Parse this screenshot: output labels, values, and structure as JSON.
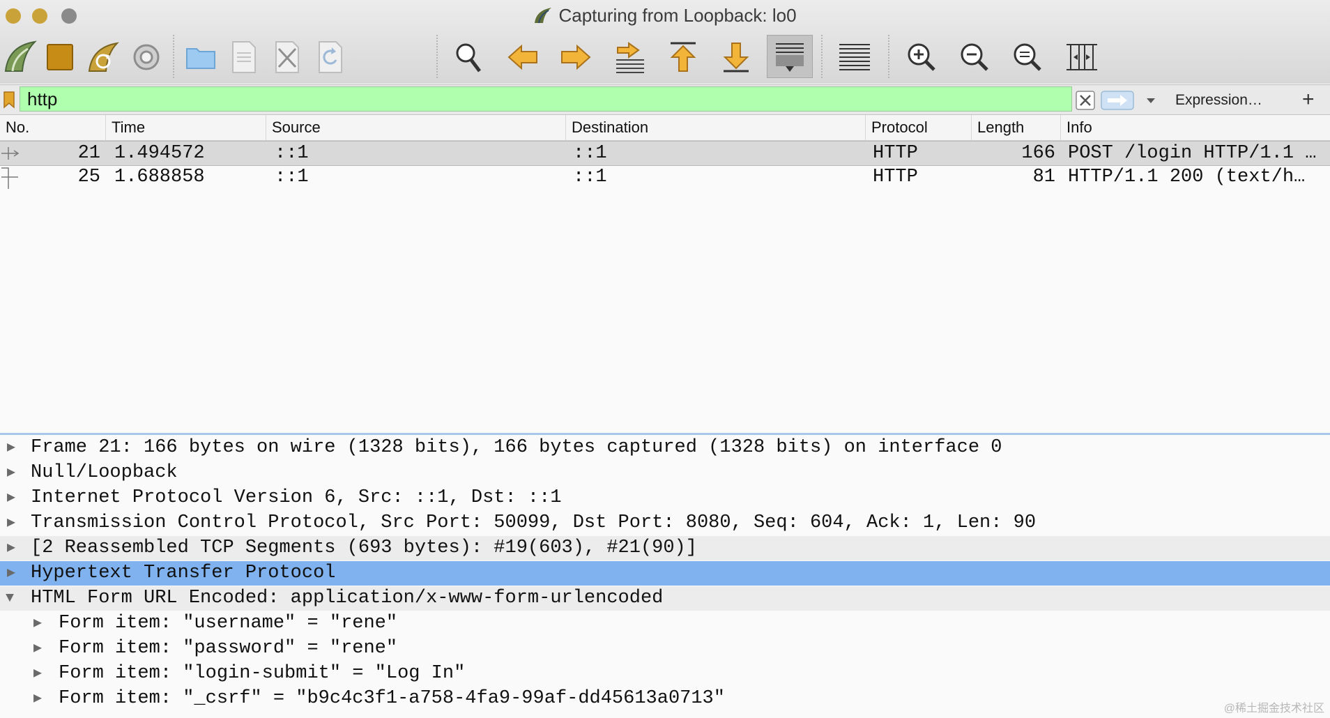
{
  "window": {
    "title": "Capturing from Loopback: lo0"
  },
  "toolbar": {
    "buttons": [
      "start-capture-icon",
      "stop-capture-icon",
      "restart-capture-icon",
      "capture-options-icon",
      "open-file-icon",
      "save-file-icon",
      "close-file-icon",
      "reload-file-icon",
      "find-packet-icon",
      "go-back-icon",
      "go-forward-icon",
      "go-to-packet-icon",
      "go-first-packet-icon",
      "go-last-packet-icon",
      "auto-scroll-icon",
      "colorize-icon",
      "zoom-in-icon",
      "zoom-out-icon",
      "normal-size-icon",
      "resize-columns-icon"
    ]
  },
  "filter": {
    "value": "http",
    "background": "#afffaf",
    "expression_label": "Expression…",
    "add_label": "+"
  },
  "packet_list": {
    "columns": [
      "No.",
      "Time",
      "Source",
      "Destination",
      "Protocol",
      "Length",
      "Info"
    ],
    "rows": [
      {
        "no": "21",
        "time": "1.494572",
        "source": "::1",
        "destination": "::1",
        "protocol": "HTTP",
        "length": "166",
        "info": "POST /login HTTP/1.1 …",
        "selected": true
      },
      {
        "no": "25",
        "time": "1.688858",
        "source": "::1",
        "destination": "::1",
        "protocol": "HTTP",
        "length": "81",
        "info": "HTTP/1.1 200  (text/h…",
        "selected": false
      }
    ]
  },
  "details": {
    "nodes": [
      {
        "text": "Frame 21: 166 bytes on wire (1328 bits), 166 bytes captured (1328 bits) on interface 0",
        "expanded": false
      },
      {
        "text": "Null/Loopback",
        "expanded": false
      },
      {
        "text": "Internet Protocol Version 6, Src: ::1, Dst: ::1",
        "expanded": false
      },
      {
        "text": "Transmission Control Protocol, Src Port: 50099, Dst Port: 8080, Seq: 604, Ack: 1, Len: 90",
        "expanded": false
      },
      {
        "text": "[2 Reassembled TCP Segments (693 bytes): #19(603), #21(90)]",
        "expanded": false
      },
      {
        "text": "Hypertext Transfer Protocol",
        "expanded": false,
        "selected": true
      },
      {
        "text": "HTML Form URL Encoded: application/x-www-form-urlencoded",
        "expanded": true
      },
      {
        "text": "Form item: \"username\" = \"rene\"",
        "expanded": false,
        "child": true
      },
      {
        "text": "Form item: \"password\" = \"rene\"",
        "expanded": false,
        "child": true
      },
      {
        "text": "Form item: \"login-submit\" = \"Log In\"",
        "expanded": false,
        "child": true
      },
      {
        "text": "Form item: \"_csrf\" = \"b9c4c3f1-a758-4fa9-99af-dd45613a0713\"",
        "expanded": false,
        "child": true
      }
    ]
  },
  "watermark": "@稀土掘金技术社区",
  "colors": {
    "selection": "#7fb2ee",
    "row_selected": "#d9d9d9",
    "splitter": "#a8c8ea"
  }
}
